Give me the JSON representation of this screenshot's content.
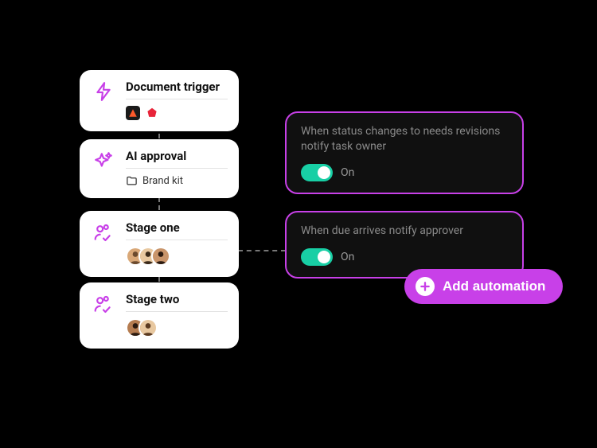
{
  "workflow": {
    "cards": [
      {
        "id": "trigger",
        "title": "Document trigger",
        "icon": "lightning",
        "apps": [
          "app-a",
          "app-b"
        ]
      },
      {
        "id": "ai",
        "title": "AI approval",
        "icon": "sparkle",
        "folder_label": "Brand kit"
      },
      {
        "id": "stage1",
        "title": "Stage one",
        "icon": "person-check",
        "avatar_count": 3
      },
      {
        "id": "stage2",
        "title": "Stage two",
        "icon": "person-check",
        "avatar_count": 2
      }
    ]
  },
  "automations": [
    {
      "id": "auto1",
      "description": "When status changes to needs revisions notify task owner",
      "toggle_on": true,
      "toggle_label": "On"
    },
    {
      "id": "auto2",
      "description": "When due arrives notify approver",
      "toggle_on": true,
      "toggle_label": "On"
    }
  ],
  "add_button_label": "Add automation",
  "colors": {
    "accent": "#c840e8",
    "toggle_on": "#18cfa5"
  }
}
